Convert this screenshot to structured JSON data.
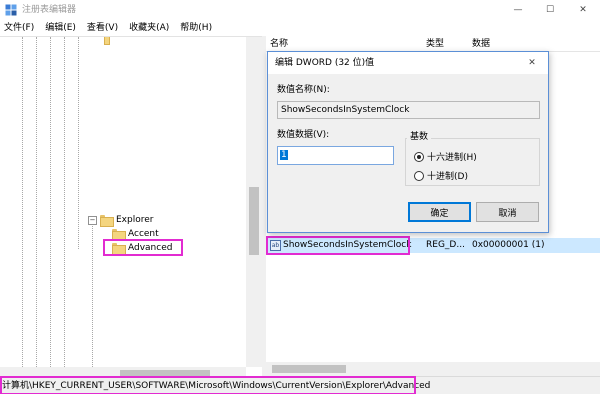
{
  "window": {
    "title": "注册表编辑器",
    "minimize_glyph": "—",
    "maximize_glyph": "☐",
    "close_glyph": "✕",
    "app_icon": "registry-editor-icon"
  },
  "menu": {
    "items": [
      "文件(F)",
      "编辑(E)",
      "查看(V)",
      "收藏夹(A)",
      "帮助(H)"
    ]
  },
  "tree": {
    "nodes": [
      {
        "label": "Explorer",
        "toggle": "−",
        "icon": "folder-icon"
      },
      {
        "label": "Accent",
        "toggle": "",
        "icon": "folder-icon"
      },
      {
        "label": "Advanced",
        "toggle": "",
        "icon": "folder-icon",
        "selected": true
      }
    ]
  },
  "list": {
    "columns": [
      "名称",
      "类型",
      "数据"
    ],
    "selected_row": {
      "name": "ShowSecondsInSystemClock",
      "type": "REG_D...",
      "data": "0x00000001 (1)",
      "icon": "registry-value-icon"
    }
  },
  "dialog": {
    "title": "编辑 DWORD (32 位)值",
    "close_glyph": "✕",
    "name_label": "数值名称(N):",
    "name_value": "ShowSecondsInSystemClock",
    "data_label": "数值数据(V):",
    "data_value": "1",
    "base_label": "基数",
    "radio_hex": "十六进制(H)",
    "radio_dec": "十进制(D)",
    "ok_label": "确定",
    "cancel_label": "取消"
  },
  "status": {
    "path": "计算机\\HKEY_CURRENT_USER\\SOFTWARE\\Microsoft\\Windows\\CurrentVersion\\Explorer\\Advanced"
  },
  "colors": {
    "highlight": "#e22bd1",
    "selection": "#cce8ff",
    "accent": "#0078d7"
  }
}
